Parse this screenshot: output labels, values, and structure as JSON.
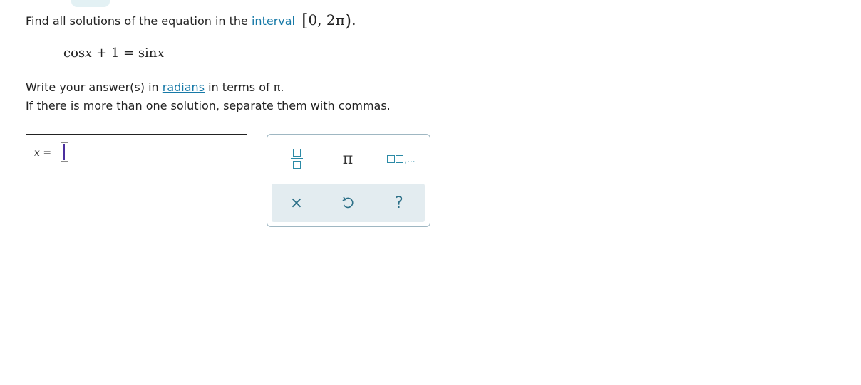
{
  "question": {
    "prompt_text": "Find all solutions of the equation in the ",
    "interval_link": "interval",
    "interval_value": "0, 2π",
    "interval_open": "[",
    "interval_close": ")",
    "interval_period": ".",
    "equation_left": "cos",
    "equation_var1": "x",
    "equation_mid": " + 1 = sin",
    "equation_var2": "x",
    "instruction1_pre": "Write your answer(s) in ",
    "instruction1_link": "radians",
    "instruction1_post": " in terms of π.",
    "instruction2": "If there is more than one solution, separate them with commas."
  },
  "answer": {
    "label_var": "x",
    "label_eq": " =",
    "value": ""
  },
  "keypad": {
    "buttons": [
      {
        "name": "fraction",
        "icon": "fraction-icon"
      },
      {
        "name": "pi",
        "label": "π"
      },
      {
        "name": "list",
        "icon": "list-icon",
        "suffix": ",..."
      }
    ],
    "actions": [
      {
        "name": "clear",
        "label": "×"
      },
      {
        "name": "undo",
        "icon": "undo-icon"
      },
      {
        "name": "help",
        "label": "?"
      }
    ]
  },
  "colors": {
    "link": "#1679a7",
    "accent": "#2b8aa6",
    "keypad_bottom_bg": "#e3ecf0"
  }
}
